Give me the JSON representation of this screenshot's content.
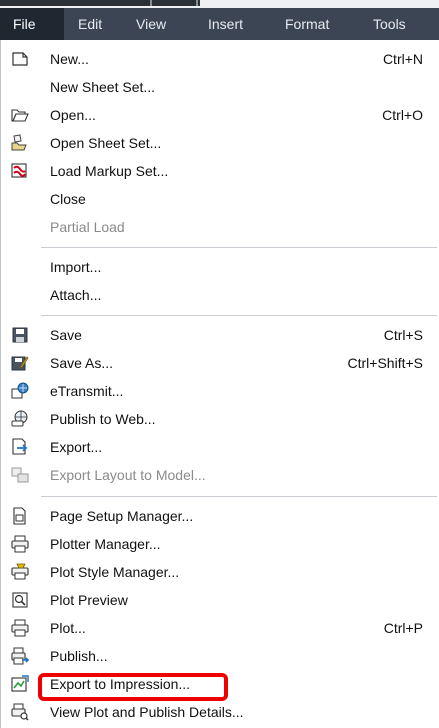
{
  "menubar": {
    "items": [
      {
        "label": "File",
        "active": true
      },
      {
        "label": "Edit",
        "active": false
      },
      {
        "label": "View",
        "active": false
      },
      {
        "label": "Insert",
        "active": false
      },
      {
        "label": "Format",
        "active": false
      },
      {
        "label": "Tools",
        "active": false
      }
    ]
  },
  "menu": {
    "items": [
      {
        "label": "New...",
        "shortcut": "Ctrl+N",
        "icon": "new-document-icon",
        "disabled": false
      },
      {
        "label": "New Sheet Set...",
        "shortcut": "",
        "icon": "",
        "disabled": false
      },
      {
        "label": "Open...",
        "shortcut": "Ctrl+O",
        "icon": "open-folder-icon",
        "disabled": false
      },
      {
        "label": "Open Sheet Set...",
        "shortcut": "",
        "icon": "open-sheet-set-icon",
        "disabled": false
      },
      {
        "label": "Load Markup Set...",
        "shortcut": "",
        "icon": "load-markup-set-icon",
        "disabled": false
      },
      {
        "label": "Close",
        "shortcut": "",
        "icon": "",
        "disabled": false
      },
      {
        "label": "Partial Load",
        "shortcut": "",
        "icon": "",
        "disabled": true
      },
      {
        "label": "Import...",
        "shortcut": "",
        "icon": "",
        "disabled": false
      },
      {
        "label": "Attach...",
        "shortcut": "",
        "icon": "",
        "disabled": false
      },
      {
        "label": "Save",
        "shortcut": "Ctrl+S",
        "icon": "save-icon",
        "disabled": false
      },
      {
        "label": "Save As...",
        "shortcut": "Ctrl+Shift+S",
        "icon": "save-as-icon",
        "disabled": false
      },
      {
        "label": "eTransmit...",
        "shortcut": "",
        "icon": "etransmit-icon",
        "disabled": false
      },
      {
        "label": "Publish to Web...",
        "shortcut": "",
        "icon": "publish-to-web-icon",
        "disabled": false
      },
      {
        "label": "Export...",
        "shortcut": "",
        "icon": "export-icon",
        "disabled": false
      },
      {
        "label": "Export Layout to Model...",
        "shortcut": "",
        "icon": "export-layout-icon",
        "disabled": true
      },
      {
        "label": "Page Setup Manager...",
        "shortcut": "",
        "icon": "page-setup-icon",
        "disabled": false
      },
      {
        "label": "Plotter Manager...",
        "shortcut": "",
        "icon": "plotter-manager-icon",
        "disabled": false
      },
      {
        "label": "Plot Style Manager...",
        "shortcut": "",
        "icon": "plot-style-manager-icon",
        "disabled": false
      },
      {
        "label": "Plot Preview",
        "shortcut": "",
        "icon": "plot-preview-icon",
        "disabled": false
      },
      {
        "label": "Plot...",
        "shortcut": "Ctrl+P",
        "icon": "plot-icon",
        "disabled": false
      },
      {
        "label": "Publish...",
        "shortcut": "",
        "icon": "publish-icon",
        "disabled": false,
        "highlighted": true
      },
      {
        "label": "Export to Impression...",
        "shortcut": "",
        "icon": "export-impression-icon",
        "disabled": false
      },
      {
        "label": "View Plot and Publish Details...",
        "shortcut": "",
        "icon": "view-plot-details-icon",
        "disabled": false
      }
    ]
  },
  "colors": {
    "menubar_bg": "#3b4553",
    "menubar_active_bg": "#1f2731",
    "highlight_border": "#ee0000",
    "disabled_text": "#8a8a8a"
  }
}
